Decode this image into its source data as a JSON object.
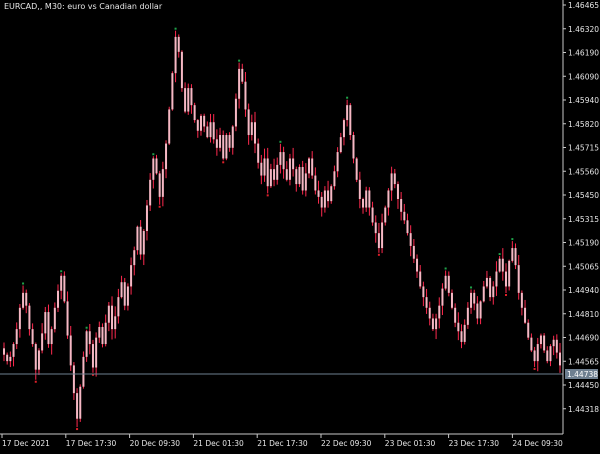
{
  "window": {
    "title": "EURCAD,, M30:  euro vs Canadian dollar"
  },
  "colors": {
    "background": "#000000",
    "axis": "#c8c8c8",
    "text": "#e6e6e6",
    "candle_body": "#f6b8c4",
    "candle_wick": "#ff2a4f",
    "high_marker": "#1fa34a",
    "low_marker": "#e0202a",
    "bid_line": "#6e7f90",
    "bid_label_bg": "#6e7f90"
  },
  "bid": {
    "price_label": "1.44738",
    "price": 1.44738
  },
  "chart_data": {
    "type": "candlestick",
    "symbol": "EURCAD",
    "timeframe": "M30",
    "ylim": [
      1.44463,
      1.46493
    ],
    "y_ticks": [
      "1.46465",
      "1.46320",
      "1.46190",
      "1.46090",
      "1.45940",
      "1.45820",
      "1.45715",
      "1.45560",
      "1.45450",
      "1.45315",
      "1.45190",
      "1.45065",
      "1.44940",
      "1.44810",
      "1.44690",
      "1.44565",
      "1.44450",
      "1.44318"
    ],
    "x_ticks": [
      "17 Dec 2021",
      "17 Dec 17:30",
      "20 Dec 09:30",
      "21 Dec 01:30",
      "21 Dec 17:30",
      "22 Dec 09:30",
      "23 Dec 01:30",
      "23 Dec 17:30",
      "24 Dec 09:30"
    ],
    "close_path": [
      1.4483,
      1.448,
      1.4482,
      1.4488,
      1.4495,
      1.4505,
      1.4512,
      1.4506,
      1.4495,
      1.4488,
      1.4476,
      1.4485,
      1.4493,
      1.4503,
      1.4488,
      1.4495,
      1.4505,
      1.4513,
      1.452,
      1.4508,
      1.4492,
      1.4478,
      1.4465,
      1.4453,
      1.4468,
      1.4482,
      1.4494,
      1.4488,
      1.4477,
      1.4491,
      1.4496,
      1.4488,
      1.4498,
      1.4506,
      1.4495,
      1.4501,
      1.451,
      1.4517,
      1.4506,
      1.4515,
      1.4525,
      1.4532,
      1.4543,
      1.453,
      1.4541,
      1.4553,
      1.4565,
      1.4575,
      1.4568,
      1.4557,
      1.457,
      1.4582,
      1.4598,
      1.4615,
      1.4632,
      1.4625,
      1.4608,
      1.4597,
      1.4608,
      1.46,
      1.4593,
      1.4588,
      1.4595,
      1.459,
      1.4585,
      1.4592,
      1.4584,
      1.458,
      1.4586,
      1.4575,
      1.4586,
      1.458,
      1.459,
      1.4603,
      1.4617,
      1.4611,
      1.4598,
      1.4586,
      1.4592,
      1.4582,
      1.4573,
      1.4567,
      1.4575,
      1.4562,
      1.457,
      1.4565,
      1.4572,
      1.4578,
      1.457,
      1.4565,
      1.4575,
      1.457,
      1.4563,
      1.4571,
      1.456,
      1.4568,
      1.4575,
      1.4567,
      1.456,
      1.4557,
      1.4552,
      1.456,
      1.4555,
      1.4562,
      1.4569,
      1.4578,
      1.4585,
      1.4593,
      1.46,
      1.4586,
      1.4575,
      1.4565,
      1.4556,
      1.4552,
      1.456,
      1.4552,
      1.4545,
      1.454,
      1.4533,
      1.4545,
      1.4552,
      1.456,
      1.4568,
      1.4563,
      1.4556,
      1.455,
      1.4546,
      1.454,
      1.4534,
      1.4528,
      1.4522,
      1.4515,
      1.451,
      1.4505,
      1.45,
      1.4495,
      1.45,
      1.4506,
      1.4514,
      1.452,
      1.4512,
      1.4505,
      1.4498,
      1.4494,
      1.4489,
      1.4497,
      1.4505,
      1.4512,
      1.4507,
      1.45,
      1.4508,
      1.4515,
      1.4519,
      1.451,
      1.4515,
      1.4522,
      1.4528,
      1.4522,
      1.4515,
      1.4527,
      1.4533,
      1.4525,
      1.4512,
      1.4505,
      1.4498,
      1.4491,
      1.4485,
      1.448,
      1.4488,
      1.4492,
      1.4485,
      1.448,
      1.4487,
      1.449,
      1.4484,
      1.4478
    ]
  }
}
